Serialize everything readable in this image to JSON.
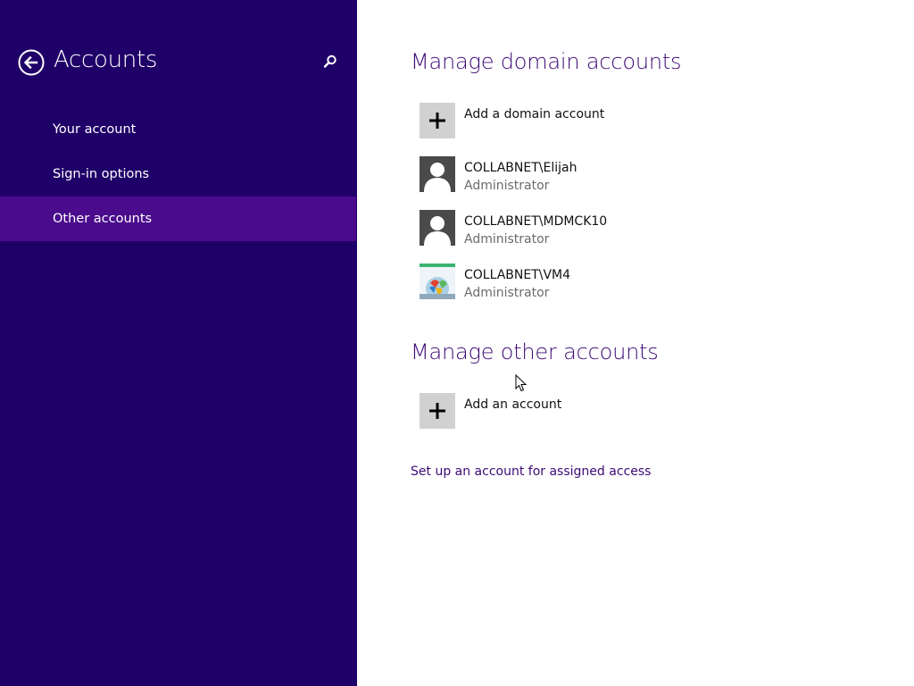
{
  "sidebar": {
    "title": "Accounts",
    "back_icon": "back-arrow-circle-icon",
    "search_icon": "search-icon",
    "items": [
      {
        "label": "Your account",
        "selected": false
      },
      {
        "label": "Sign-in options",
        "selected": false
      },
      {
        "label": "Other accounts",
        "selected": true
      }
    ]
  },
  "main": {
    "domain_section": {
      "title": "Manage domain accounts",
      "add_label": "Add a domain account",
      "accounts": [
        {
          "name": "COLLABNET\\Elijah",
          "role": "Administrator",
          "avatar": "default-user-icon"
        },
        {
          "name": "COLLABNET\\MDMCK10",
          "role": "Administrator",
          "avatar": "default-user-icon"
        },
        {
          "name": "COLLABNET\\VM4",
          "role": "Administrator",
          "avatar": "picture-avatar"
        }
      ]
    },
    "other_section": {
      "title": "Manage other accounts",
      "add_label": "Add an account"
    },
    "assigned_access_link": "Set up an account for assigned access"
  },
  "colors": {
    "sidebar_bg": "#1f0068",
    "selected_item_bg": "#4a0b8c",
    "accent_text": "#3d0a75"
  }
}
